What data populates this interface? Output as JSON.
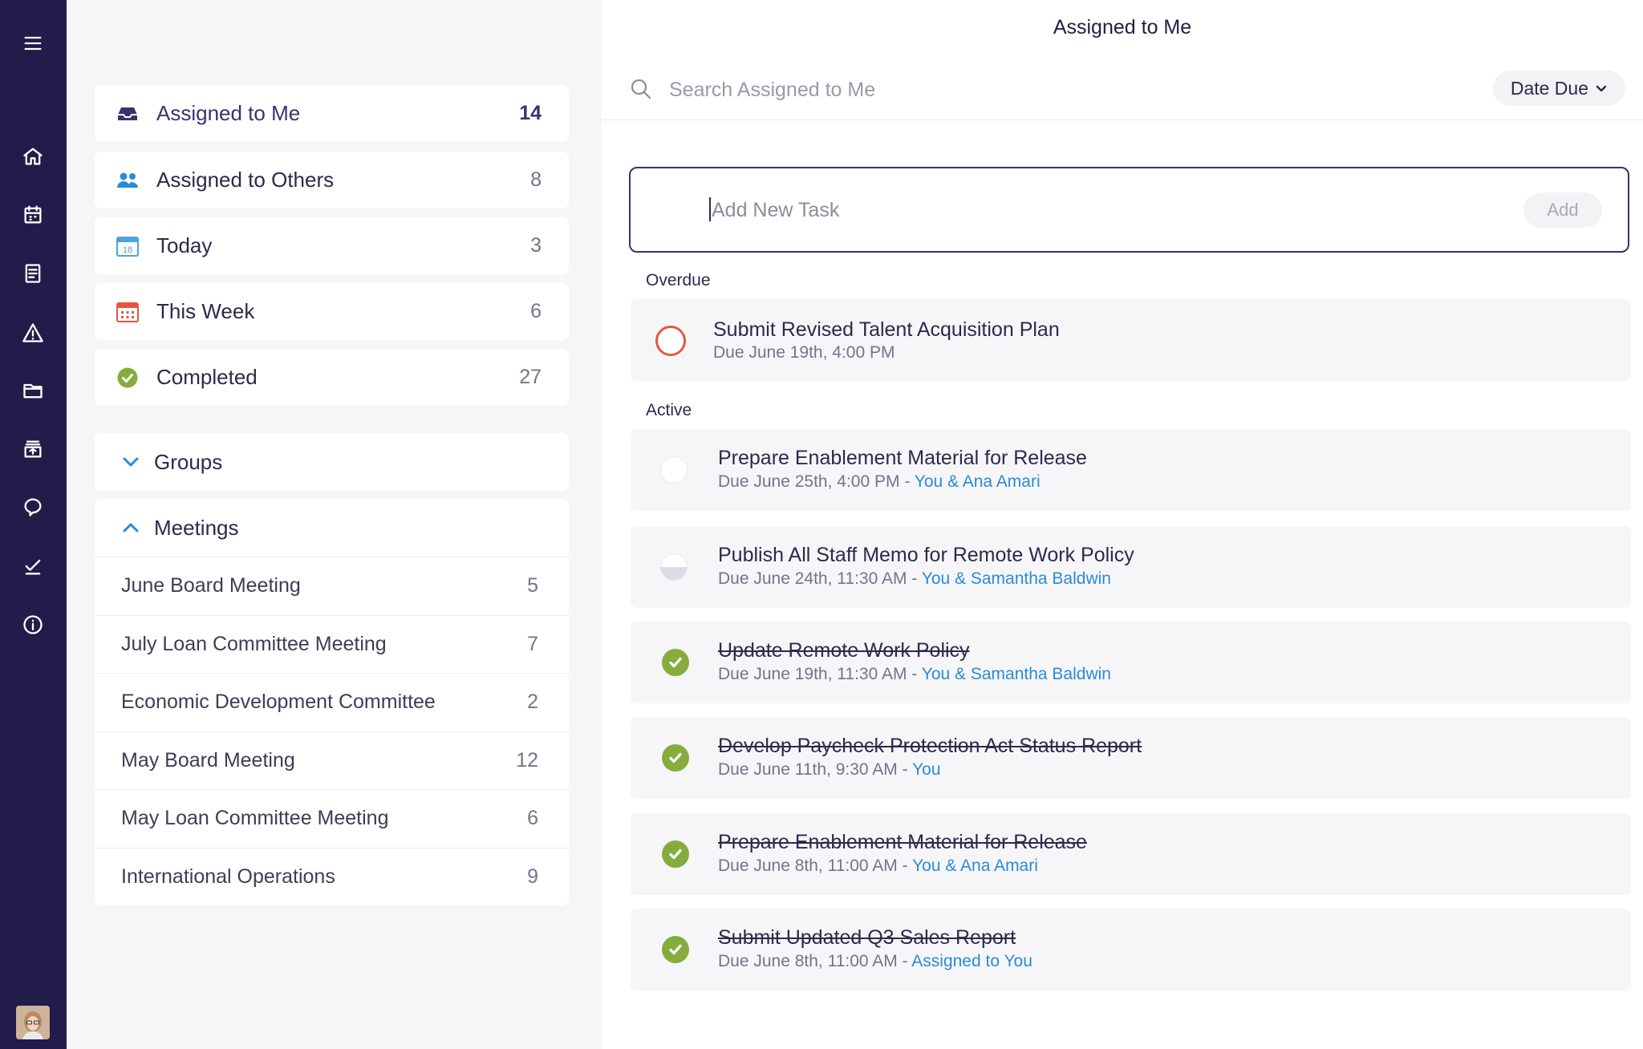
{
  "main": {
    "title": "Assigned to Me",
    "search_placeholder": "Search Assigned to Me",
    "sort_label": "Date Due",
    "add_placeholder": "Add New Task",
    "add_button": "Add"
  },
  "nav": [
    {
      "label": "Assigned to Me",
      "count": "14",
      "icon": "inbox-icon",
      "color": "#3a3270"
    },
    {
      "label": "Assigned to Others",
      "count": "8",
      "icon": "users-icon",
      "color": "#2a8bd8"
    },
    {
      "label": "Today",
      "count": "3",
      "icon": "calendar-today-icon",
      "color": "#4fa3d8"
    },
    {
      "label": "This Week",
      "count": "6",
      "icon": "calendar-week-icon",
      "color": "#e8553e"
    },
    {
      "label": "Completed",
      "count": "27",
      "icon": "check-circle-icon",
      "color": "#84ad3e"
    }
  ],
  "today_icon_day": "18",
  "groups_label": "Groups",
  "meetings": {
    "label": "Meetings",
    "items": [
      {
        "label": "June Board Meeting",
        "count": "5"
      },
      {
        "label": "July Loan Committee Meeting",
        "count": "7"
      },
      {
        "label": "Economic Development Committee",
        "count": "2"
      },
      {
        "label": "May Board Meeting",
        "count": "12"
      },
      {
        "label": "May Loan Committee Meeting",
        "count": "6"
      },
      {
        "label": "International Operations",
        "count": "9"
      }
    ]
  },
  "sections": {
    "overdue": "Overdue",
    "active": "Active"
  },
  "tasks": [
    {
      "title": "Submit Revised Talent Acquisition Plan",
      "due": "Due June 19th, 4:00 PM",
      "sep": "",
      "who": "",
      "status": "overdue"
    },
    {
      "title": "Prepare Enablement Material for Release",
      "due": "Due June 25th, 4:00 PM",
      "sep": " - ",
      "who": "You & Ana Amari",
      "status": "not-started"
    },
    {
      "title": "Publish All Staff Memo for Remote Work Policy",
      "due": "Due June 24th, 11:30 AM",
      "sep": " - ",
      "who": "You & Samantha Baldwin",
      "status": "in-progress"
    },
    {
      "title": "Update Remote Work Policy",
      "due": "Due June 19th, 11:30 AM",
      "sep": " - ",
      "who": "You & Samantha Baldwin",
      "status": "completed"
    },
    {
      "title": "Develop Paycheck Protection Act Status Report",
      "due": "Due June 11th, 9:30 AM",
      "sep": " - ",
      "who": "You",
      "status": "completed"
    },
    {
      "title": "Prepare Enablement Material for Release",
      "due": "Due June 8th, 11:00 AM",
      "sep": " - ",
      "who": "You & Ana Amari",
      "status": "completed"
    },
    {
      "title": "Submit Updated Q3 Sales Report",
      "due": "Due June 8th, 11:00 AM",
      "sep": " - ",
      "who": "Assigned to You",
      "status": "completed"
    }
  ],
  "rail_icons": [
    "menu-icon",
    "home-icon",
    "calendar-icon",
    "document-icon",
    "alert-icon",
    "folder-icon",
    "archive-icon",
    "chat-icon",
    "checkmark-icon",
    "info-icon"
  ]
}
